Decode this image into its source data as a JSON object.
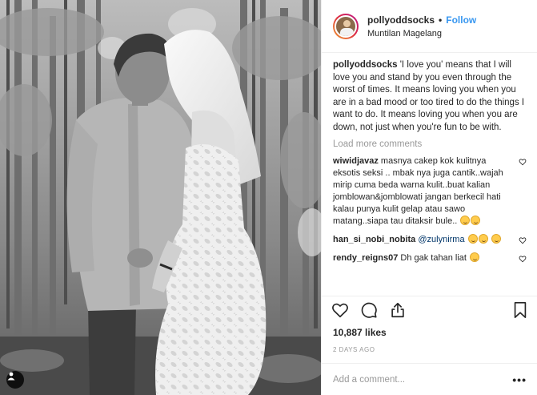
{
  "post": {
    "username": "pollyoddsocks",
    "separator": "•",
    "follow_label": "Follow",
    "location": "Muntilan Magelang",
    "caption_user": "pollyoddsocks",
    "caption_text": "'I love you' means that I will love you and stand by you even through the worst of times. It means loving you when you are in a bad mood or too tired to do the things I want to do. It means loving you when you are down, not just when you're fun to be with.",
    "load_more": "Load more comments",
    "likes": "10,887 likes",
    "date": "2 DAYS AGO",
    "add_comment_placeholder": "Add a comment...",
    "more_options": "•••"
  },
  "comments": [
    {
      "user": "wiwidjavaz",
      "text": "masnya cakep kok kulitnya eksotis seksi .. mbak nya juga cantik..wajah mirip cuma beda warna kulit..buat kalian jomblowan&jomblowati jangan berkecil hati kalau punya kulit gelap atau sawo matang..siapa tau ditaksir bule..",
      "emojis": 2
    },
    {
      "user": "han_si_nobi_nobita",
      "mention": "@zulynirma",
      "emojis": 3
    },
    {
      "user": "rendy_reigns07",
      "text": "Dh gak tahan liat",
      "emojis": 1
    }
  ],
  "icons": {
    "like": "heart-icon",
    "comment": "comment-bubble-icon",
    "share": "share-icon",
    "save": "bookmark-icon",
    "tag": "person-tag-icon"
  },
  "colors": {
    "link_blue": "#3897f0",
    "muted": "#999999",
    "text": "#262626",
    "divider": "#efefef"
  }
}
